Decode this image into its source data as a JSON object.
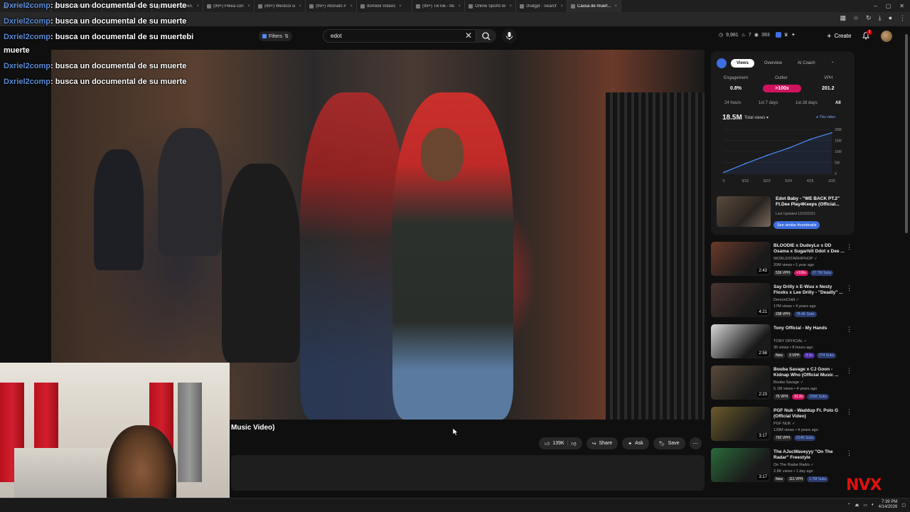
{
  "browser": {
    "tabs": [
      {
        "label": "Funny 3D A..."
      },
      {
        "label": "(99+) El Gran Vac..."
      },
      {
        "label": "(99+) #26b #louie..."
      },
      {
        "label": "(99+) #mettiven..."
      },
      {
        "label": "(99+) Pelea con C..."
      },
      {
        "label": "(99+) Westcol se..."
      },
      {
        "label": "(99+) #donato #..."
      },
      {
        "label": "domiilol Videos"
      },
      {
        "label": "(99+) TikTok - Ma..."
      },
      {
        "label": "Online Sports Bet..."
      },
      {
        "label": "chatgpt - Search"
      },
      {
        "label": "Causa de muert..."
      }
    ],
    "window_controls": [
      "–",
      "▢",
      "✕"
    ]
  },
  "chat": [
    {
      "user": "Dxriel2comp",
      "message": ": busca un documental de su muerte"
    },
    {
      "user": "Dxriel2comp",
      "message": ": busca un documental de su muerte"
    },
    {
      "user": "Dxriel2comp",
      "message": ": busca un documental de su muertebi"
    },
    {
      "user": "",
      "message": "muerte"
    },
    {
      "user": "Dxriel2comp",
      "message": ": busca un documental de su muerte"
    },
    {
      "user": "Dxriel2comp",
      "message": ": busca un documental de su muerte"
    }
  ],
  "masthead": {
    "filters_label": "Filters",
    "search_value": "edot",
    "stats": [
      "9,981",
      "7",
      "393"
    ],
    "create_label": "Create",
    "notif_count": "2"
  },
  "player": {
    "caption": "Music Video)"
  },
  "actions": {
    "likes": "139K",
    "share": "Share",
    "ask": "Ask",
    "save": "Save"
  },
  "panel": {
    "tabs": [
      "Views",
      "Overview",
      "AI Coach"
    ],
    "metrics": [
      {
        "label": "Engagement",
        "value": "0.8%"
      },
      {
        "label": "Outlier",
        "value": ">100x"
      },
      {
        "label": "VPH",
        "value": "201.2"
      }
    ],
    "ranges": [
      "24 hours",
      "1st 7 days",
      "1st 28 days",
      "All"
    ],
    "total_views": "18.5M",
    "views_select": "Total views",
    "legend": "This video",
    "y_ticks": [
      "20M",
      "15M",
      "10M",
      "5M",
      "0"
    ],
    "x_ticks": [
      "0",
      "9/22",
      "8/23",
      "5/24",
      "4/25",
      "3/26"
    ],
    "ref_title": "Edot Baby - \"WE BACK PT.2\" Ft.Dee Play4Keeps (Official...",
    "ref_date": "Last Updated 12/23/2021",
    "ref_button": "See similar thumbnails"
  },
  "chart_data": {
    "type": "line",
    "x": [
      "0",
      "9/22",
      "8/23",
      "5/24",
      "4/25",
      "3/26"
    ],
    "series": [
      {
        "name": "This video",
        "values": [
          0.5,
          4.5,
          8.2,
          11.5,
          15.5,
          18.5
        ]
      }
    ],
    "ylim": [
      0,
      20
    ]
  },
  "recs": [
    {
      "title": "BLOODIE x DudeyLo x DD Osama x Sugarhill Ddot x Dee ...",
      "channel": "WORLDSTARHIPHOP",
      "meta": "20M views • 1 year ago",
      "duration": "2:43",
      "badges": [
        {
          "t": "539 VPH",
          "k": "vph"
        },
        {
          "t": ">100x",
          "k": "red"
        },
        {
          "t": "27.7M Subs",
          "k": "blue"
        }
      ],
      "thumb": "#6a3a2a"
    },
    {
      "title": "Say Drilly x E-Wuu x Nesty Floxks x Lee Drilly - \"Deadly\" ...",
      "channel": "DemonChild",
      "meta": "17M views • 4 years ago",
      "duration": "4:21",
      "badges": [
        {
          "t": "238 VPH",
          "k": "vph"
        },
        {
          "t": "78.4K Subs",
          "k": "blue"
        }
      ],
      "thumb": "#4a3430"
    },
    {
      "title": "Tony Official - My Hands",
      "channel": "TONY OFFICIAL",
      "meta": "35 views • 8 hours ago",
      "duration": "2:58",
      "badges": [
        {
          "t": "New",
          "k": "vph"
        },
        {
          "t": "3 VPH",
          "k": "vph"
        },
        {
          "t": "0.1x",
          "k": "purple"
        },
        {
          "t": "374 Subs",
          "k": "blue"
        }
      ],
      "thumb": "#d8d8d8"
    },
    {
      "title": "Bouba Savage x CJ Goon - Kidnap Who (Official Music ...",
      "channel": "Bouba Savage",
      "meta": "5.1M views • 4 years ago",
      "duration": "2:23",
      "badges": [
        {
          "t": "75 VPH",
          "k": "vph"
        },
        {
          "t": "91.8x",
          "k": "red"
        },
        {
          "t": "155K Subs",
          "k": "blue"
        }
      ],
      "thumb": "#5a4a3a"
    },
    {
      "title": "PGF Nuk - Waddup Ft. Polo G (Official Video)",
      "channel": "PGF NUK",
      "meta": "128M views • 4 years ago",
      "duration": "3:17",
      "badges": [
        {
          "t": "792 VPH",
          "k": "vph"
        },
        {
          "t": "514K Subs",
          "k": "blue"
        }
      ],
      "thumb": "#6a5a2a"
    },
    {
      "title": "The AJscWaveyyy \"On The Radar\" Freestyle",
      "channel": "On The Radar Radio",
      "meta": "2.8K views • 1 day ago",
      "duration": "3:17",
      "badges": [
        {
          "t": "New",
          "k": "vph"
        },
        {
          "t": "111 VPH",
          "k": "vph"
        },
        {
          "t": "1.7M Subs",
          "k": "blue"
        }
      ],
      "thumb": "#2a6a3a"
    }
  ],
  "watermark": "NVX",
  "taskbar": {
    "time": "7:39 PM",
    "date": "4/14/2026"
  }
}
